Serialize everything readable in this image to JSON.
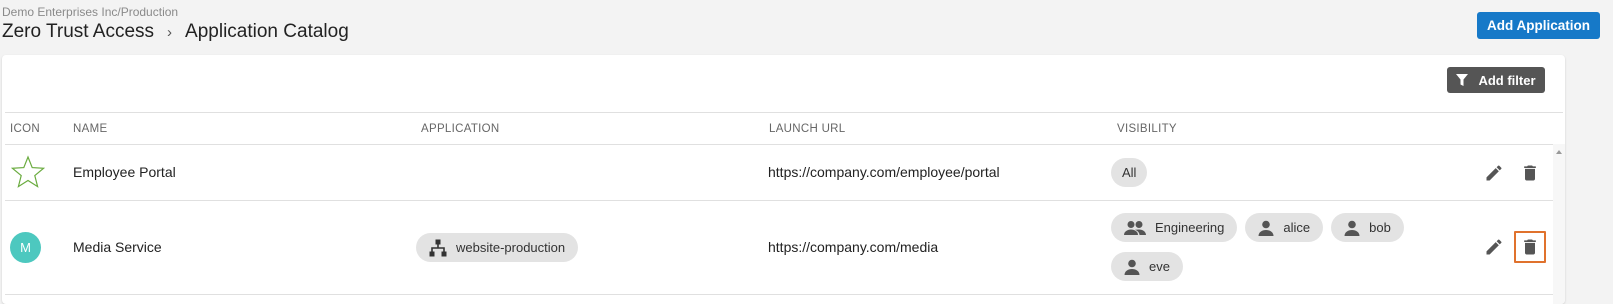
{
  "header": {
    "org_path": "Demo Enterprises Inc/Production",
    "breadcrumb": [
      "Zero Trust Access",
      "Application Catalog"
    ],
    "separator": "›",
    "add_button": "Add Application"
  },
  "toolbar": {
    "filter_label": "Add filter"
  },
  "table": {
    "columns": [
      "ICON",
      "NAME",
      "APPLICATION",
      "LAUNCH URL",
      "VISIBILITY"
    ],
    "rows": [
      {
        "icon": "star-icon",
        "name": "Employee Portal",
        "application": "",
        "launch_url": "https://company.com/employee/portal",
        "visibility": [
          {
            "label": "All",
            "type": "all"
          }
        ]
      },
      {
        "icon": "avatar",
        "avatar_letter": "M",
        "name": "Media Service",
        "application": "website-production",
        "launch_url": "https://company.com/media",
        "visibility": [
          {
            "label": "Engineering",
            "type": "group"
          },
          {
            "label": "alice",
            "type": "user"
          },
          {
            "label": "bob",
            "type": "user"
          },
          {
            "label": "eve",
            "type": "user"
          }
        ]
      }
    ]
  },
  "colors": {
    "accent": "#1679c8",
    "avatar": "#4dc8bf",
    "star": "#6aab3f",
    "highlight": "#e0722d"
  }
}
